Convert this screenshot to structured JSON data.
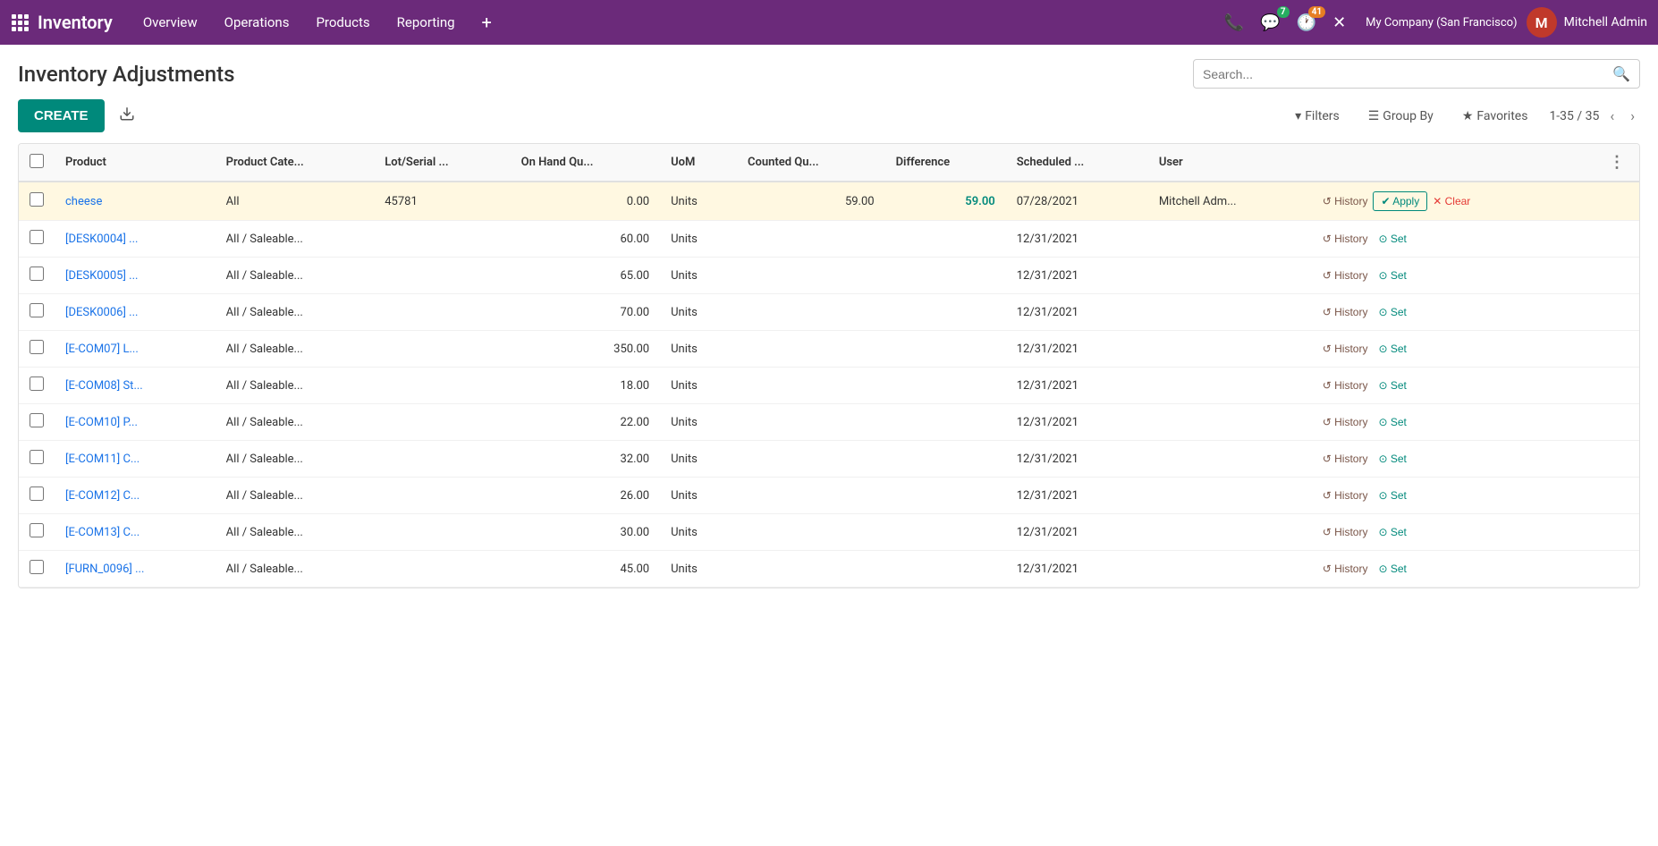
{
  "topnav": {
    "app_name": "Inventory",
    "menu_items": [
      "Overview",
      "Operations",
      "Products",
      "Reporting"
    ],
    "plus_label": "+",
    "phone_icon": "📞",
    "chat_icon": "💬",
    "chat_badge": "7",
    "clock_icon": "🕐",
    "clock_badge": "41",
    "close_icon": "✕",
    "company": "My Company (San Francisco)",
    "user": "Mitchell Admin"
  },
  "page": {
    "title": "Inventory Adjustments",
    "search_placeholder": "Search..."
  },
  "toolbar": {
    "create_label": "CREATE",
    "download_icon": "⬇",
    "filters_label": "Filters",
    "group_by_label": "Group By",
    "favorites_label": "Favorites",
    "pagination": "1-35 / 35"
  },
  "table": {
    "columns": [
      "Product",
      "Product Cate...",
      "Lot/Serial ...",
      "On Hand Qu...",
      "UoM",
      "Counted Qu...",
      "Difference",
      "Scheduled ...",
      "User"
    ],
    "rows": [
      {
        "product": "cheese",
        "category": "All",
        "lot": "45781",
        "on_hand": "0.00",
        "uom": "Units",
        "counted": "59.00",
        "difference": "59.00",
        "difference_class": "positive",
        "scheduled": "07/28/2021",
        "user": "Mitchell Adm...",
        "actions": [
          "history",
          "apply",
          "clear"
        ],
        "highlighted": true
      },
      {
        "product": "[DESK0004] ...",
        "category": "All / Saleable...",
        "lot": "",
        "on_hand": "60.00",
        "uom": "Units",
        "counted": "",
        "difference": "",
        "difference_class": "",
        "scheduled": "12/31/2021",
        "user": "",
        "actions": [
          "history",
          "set"
        ],
        "highlighted": false
      },
      {
        "product": "[DESK0005] ...",
        "category": "All / Saleable...",
        "lot": "",
        "on_hand": "65.00",
        "uom": "Units",
        "counted": "",
        "difference": "",
        "difference_class": "",
        "scheduled": "12/31/2021",
        "user": "",
        "actions": [
          "history",
          "set"
        ],
        "highlighted": false
      },
      {
        "product": "[DESK0006] ...",
        "category": "All / Saleable...",
        "lot": "",
        "on_hand": "70.00",
        "uom": "Units",
        "counted": "",
        "difference": "",
        "difference_class": "",
        "scheduled": "12/31/2021",
        "user": "",
        "actions": [
          "history",
          "set"
        ],
        "highlighted": false
      },
      {
        "product": "[E-COM07] L...",
        "category": "All / Saleable...",
        "lot": "",
        "on_hand": "350.00",
        "uom": "Units",
        "counted": "",
        "difference": "",
        "difference_class": "",
        "scheduled": "12/31/2021",
        "user": "",
        "actions": [
          "history",
          "set"
        ],
        "highlighted": false
      },
      {
        "product": "[E-COM08] St...",
        "category": "All / Saleable...",
        "lot": "",
        "on_hand": "18.00",
        "uom": "Units",
        "counted": "",
        "difference": "",
        "difference_class": "",
        "scheduled": "12/31/2021",
        "user": "",
        "actions": [
          "history",
          "set"
        ],
        "highlighted": false
      },
      {
        "product": "[E-COM10] P...",
        "category": "All / Saleable...",
        "lot": "",
        "on_hand": "22.00",
        "uom": "Units",
        "counted": "",
        "difference": "",
        "difference_class": "",
        "scheduled": "12/31/2021",
        "user": "",
        "actions": [
          "history",
          "set"
        ],
        "highlighted": false
      },
      {
        "product": "[E-COM11] C...",
        "category": "All / Saleable...",
        "lot": "",
        "on_hand": "32.00",
        "uom": "Units",
        "counted": "",
        "difference": "",
        "difference_class": "",
        "scheduled": "12/31/2021",
        "user": "",
        "actions": [
          "history",
          "set"
        ],
        "highlighted": false
      },
      {
        "product": "[E-COM12] C...",
        "category": "All / Saleable...",
        "lot": "",
        "on_hand": "26.00",
        "uom": "Units",
        "counted": "",
        "difference": "",
        "difference_class": "",
        "scheduled": "12/31/2021",
        "user": "",
        "actions": [
          "history",
          "set"
        ],
        "highlighted": false
      },
      {
        "product": "[E-COM13] C...",
        "category": "All / Saleable...",
        "lot": "",
        "on_hand": "30.00",
        "uom": "Units",
        "counted": "",
        "difference": "",
        "difference_class": "",
        "scheduled": "12/31/2021",
        "user": "",
        "actions": [
          "history",
          "set"
        ],
        "highlighted": false
      },
      {
        "product": "[FURN_0096] ...",
        "category": "All / Saleable...",
        "lot": "",
        "on_hand": "45.00",
        "uom": "Units",
        "counted": "",
        "difference": "",
        "difference_class": "",
        "scheduled": "12/31/2021",
        "user": "",
        "actions": [
          "history",
          "set"
        ],
        "highlighted": false
      }
    ]
  },
  "icons": {
    "history": "↺",
    "set": "⊙",
    "apply": "✔",
    "clear": "✕",
    "filter": "▾",
    "groupby": "☰",
    "star": "★",
    "chevron_left": "‹",
    "chevron_right": "›",
    "grid": "⊞",
    "more": "⋮"
  }
}
